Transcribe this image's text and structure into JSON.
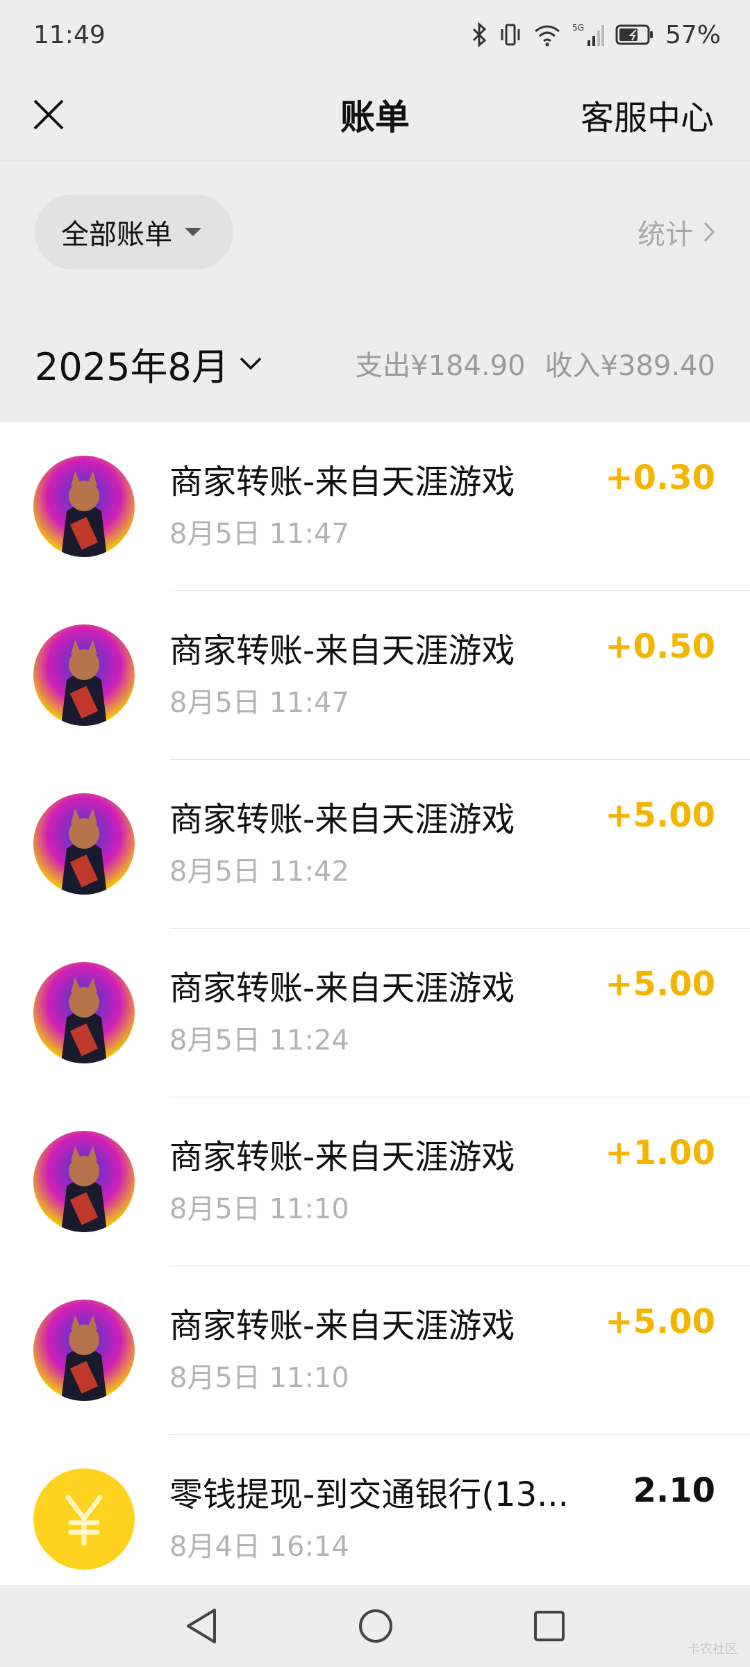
{
  "status": {
    "time": "11:49",
    "battery": "57%"
  },
  "header": {
    "title": "账单",
    "service_label": "客服中心"
  },
  "filter": {
    "label": "全部账单",
    "stats_label": "统计"
  },
  "month": {
    "label": "2025年8月",
    "expense": "支出¥184.90",
    "income": "收入¥389.40"
  },
  "transactions": [
    {
      "title": "商家转账-来自天涯游戏",
      "time": "8月5日 11:47",
      "amount": "+0.30",
      "icon": "merchant-avatar"
    },
    {
      "title": "商家转账-来自天涯游戏",
      "time": "8月5日 11:47",
      "amount": "+0.50",
      "icon": "merchant-avatar"
    },
    {
      "title": "商家转账-来自天涯游戏",
      "time": "8月5日 11:42",
      "amount": "+5.00",
      "icon": "merchant-avatar"
    },
    {
      "title": "商家转账-来自天涯游戏",
      "time": "8月5日 11:24",
      "amount": "+5.00",
      "icon": "merchant-avatar"
    },
    {
      "title": "商家转账-来自天涯游戏",
      "time": "8月5日 11:10",
      "amount": "+1.00",
      "icon": "merchant-avatar"
    },
    {
      "title": "商家转账-来自天涯游戏",
      "time": "8月5日 11:10",
      "amount": "+5.00",
      "icon": "merchant-avatar"
    },
    {
      "title": "零钱提现-到交通银行(13...",
      "time": "8月4日 16:14",
      "amount": "2.10",
      "icon": "yen-coin-icon"
    }
  ],
  "colors": {
    "income": "#f5b400",
    "coin": "#ffd21f",
    "background": "#ededed"
  },
  "watermark": "卡农社区"
}
